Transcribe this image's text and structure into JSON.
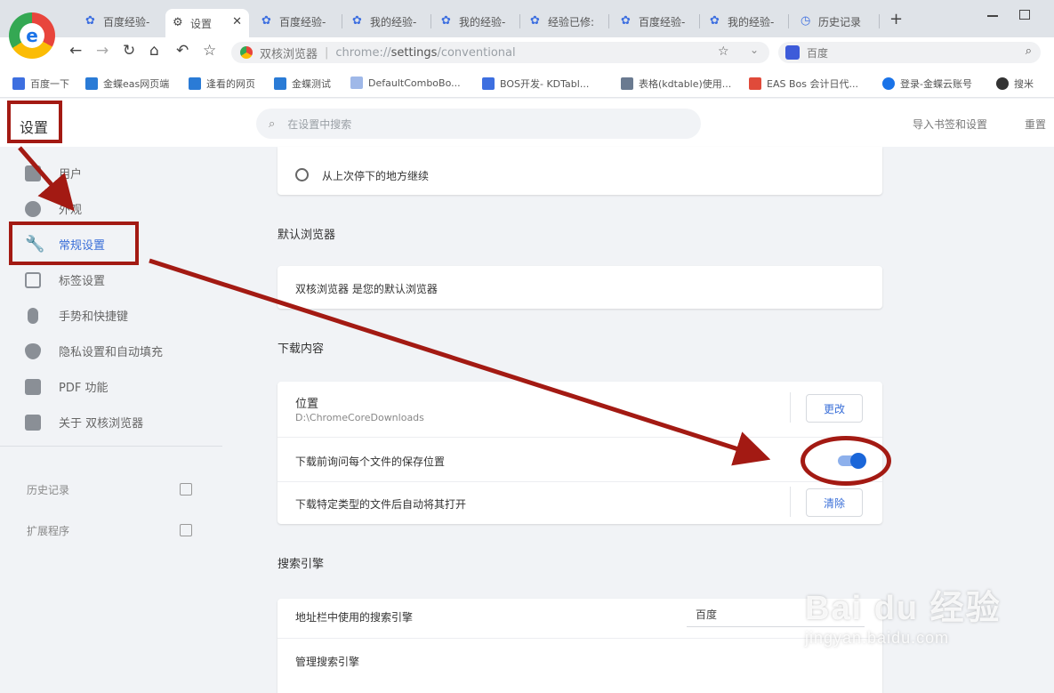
{
  "browser": {
    "tabs": [
      {
        "label": "百度经验-"
      },
      {
        "label": "设置"
      },
      {
        "label": "百度经验-"
      },
      {
        "label": "我的经验-"
      },
      {
        "label": "我的经验-"
      },
      {
        "label": "经验已修:"
      },
      {
        "label": "百度经验-"
      },
      {
        "label": "我的经验-"
      },
      {
        "label": "历史记录"
      }
    ],
    "address_title": "双核浏览器",
    "address_url_prefix": "chrome://",
    "address_url_bold": "settings",
    "address_url_suffix": "/conventional",
    "search_placeholder": "百度"
  },
  "bookmarks": [
    {
      "label": "百度一下",
      "color": "#3d6fe0"
    },
    {
      "label": "金蝶eas网页端",
      "color": "#2a7bd6"
    },
    {
      "label": "逢看的网页",
      "color": "#2a7bd6"
    },
    {
      "label": "金蝶测试",
      "color": "#2a7bd6"
    },
    {
      "label": "DefaultComboBo...",
      "color": "#9fb8e8"
    },
    {
      "label": "BOS开发- KDTabl...",
      "color": "#3d6fe0"
    },
    {
      "label": "表格(kdtable)使用...",
      "color": "#6a7a90"
    },
    {
      "label": "EAS Bos 会计日代...",
      "color": "#e04a3a"
    },
    {
      "label": "登录-金蝶云账号",
      "color": "#1a73e8"
    },
    {
      "label": "搜米",
      "color": "#333333"
    }
  ],
  "settings": {
    "title": "设置",
    "search_placeholder": "在设置中搜索",
    "header_links": [
      "导入书签和设置",
      "重置"
    ],
    "sidebar": [
      {
        "label": "用户"
      },
      {
        "label": "外观"
      },
      {
        "label": "常规设置"
      },
      {
        "label": "标签设置"
      },
      {
        "label": "手势和快捷键"
      },
      {
        "label": "隐私设置和自动填充"
      },
      {
        "label": "PDF 功能"
      },
      {
        "label": "关于 双核浏览器"
      }
    ],
    "sidebar_links": [
      {
        "label": "历史记录"
      },
      {
        "label": "扩展程序"
      }
    ],
    "startup_option": "从上次停下的地方继续",
    "default_browser": {
      "heading": "默认浏览器",
      "text": "双核浏览器 是您的默认浏览器"
    },
    "downloads": {
      "heading": "下载内容",
      "location_label": "位置",
      "location_value": "D:\\ChromeCoreDownloads",
      "change_button": "更改",
      "ask_label": "下载前询问每个文件的保存位置",
      "ask_enabled": true,
      "auto_open_label": "下载特定类型的文件后自动将其打开",
      "clear_button": "清除"
    },
    "search_engine": {
      "heading": "搜索引擎",
      "engine_label": "地址栏中使用的搜索引擎",
      "engine_value": "百度",
      "manage_label": "管理搜索引擎"
    }
  },
  "watermark": {
    "main": "Bai du 经验",
    "sub": "jingyan.baidu.com"
  },
  "colors": {
    "annotation": "#a31a13",
    "accent": "#3a6fd8",
    "toggle": "#1a66d9"
  }
}
